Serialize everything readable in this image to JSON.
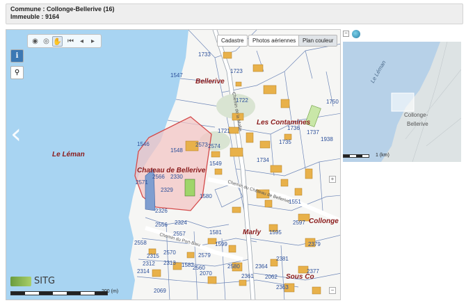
{
  "parcel_info": {
    "commune_line": "Commune : Collonge-Bellerive (16)",
    "immeuble_line": "Immeuble : 9164"
  },
  "toolbar": {
    "buttons": [
      {
        "name": "measure-distance-icon",
        "glyph": "◉"
      },
      {
        "name": "measure-area-icon",
        "glyph": "◎"
      },
      {
        "name": "pan-hand-icon",
        "glyph": "✋"
      },
      {
        "name": "first-extent-icon",
        "glyph": "⏮"
      },
      {
        "name": "previous-extent-icon",
        "glyph": "◂"
      },
      {
        "name": "next-extent-icon",
        "glyph": "▸"
      }
    ]
  },
  "layers": {
    "cadastre_label": "Cadastre",
    "aerial_label": "Photos aériennes",
    "color_plan_label": "Plan couleur",
    "selected": "Plan couleur"
  },
  "side_buttons": {
    "info_glyph": "i",
    "search_glyph": "⚲"
  },
  "navigation": {
    "prev_glyph": "‹",
    "next_glyph": "›"
  },
  "place_names": {
    "lake": "Le Léman",
    "bellerive": "Bellerive",
    "les_contamines": "Les Contamines",
    "chateau": "Chateau de Bellerive",
    "marly": "Marly",
    "collonge": "Collonge",
    "sous_co": "Sous Co"
  },
  "roads": {
    "chemin_chateau": "Chemin du Château de Bellerive",
    "chemin_port": "Chemin du Port-Bleu",
    "chemin_mollie": "Chemin de la Mollie"
  },
  "parcel_numbers": [
    "1733",
    "1723",
    "1547",
    "1722",
    "1750",
    "1736",
    "1737",
    "1938",
    "1721",
    "1735",
    "1546",
    "1548",
    "2573",
    "2574",
    "1734",
    "1549",
    "2566",
    "2330",
    "2571",
    "2329",
    "1580",
    "1551",
    "2326",
    "2324",
    "2556",
    "2557",
    "1581",
    "2597",
    "2558",
    "2315",
    "2312",
    "2570",
    "2313",
    "1582",
    "2579",
    "1595",
    "1599",
    "2379",
    "2314",
    "2560",
    "2580",
    "2364",
    "2381",
    "2070",
    "2069",
    "2361",
    "2062",
    "2363",
    "2377"
  ],
  "highlight_color": "#f3c6c6",
  "highlight_stroke": "#d44a4a",
  "building_color": "#e8b14a",
  "lake_color": "#a8d4f2",
  "scale": {
    "main_label": "200 (m)",
    "mini_label": "1 (km)"
  },
  "logo": {
    "text": "SITG"
  },
  "minimap": {
    "lake_label": "Le Léman",
    "town_line1": "Collonge-",
    "town_line2": "Bellerive",
    "collapse_glyph": "−"
  }
}
